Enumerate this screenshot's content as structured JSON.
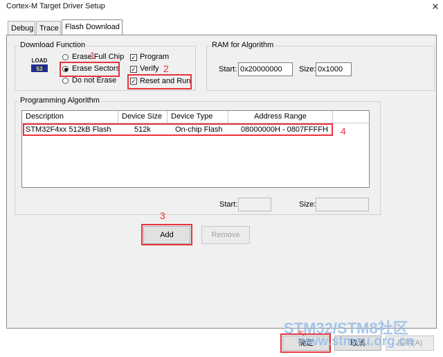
{
  "window": {
    "title": "Cortex-M Target Driver Setup",
    "close_glyph": "✕"
  },
  "tabs": [
    {
      "label": "Debug"
    },
    {
      "label": "Trace"
    },
    {
      "label": "Flash Download"
    }
  ],
  "download_function": {
    "title": "Download Function",
    "load_icon_text": [
      "LOAD",
      "53"
    ],
    "erase_options": [
      {
        "label": "Erase Full Chip",
        "selected": false
      },
      {
        "label": "Erase Sectors",
        "selected": true
      },
      {
        "label": "Do not Erase",
        "selected": false
      }
    ],
    "checkboxes": [
      {
        "label": "Program",
        "checked": true
      },
      {
        "label": "Verify",
        "checked": true
      },
      {
        "label": "Reset and Run",
        "checked": true
      }
    ]
  },
  "ram": {
    "title": "RAM for Algorithm",
    "start_label": "Start:",
    "start_value": "0x20000000",
    "size_label": "Size:",
    "size_value": "0x1000"
  },
  "programming_algorithm": {
    "title": "Programming Algorithm",
    "columns": [
      "Description",
      "Device Size",
      "Device Type",
      "Address Range"
    ],
    "rows": [
      {
        "description": "STM32F4xx 512kB Flash",
        "size": "512k",
        "type": "On-chip Flash",
        "range": "08000000H - 0807FFFFH"
      }
    ],
    "start_label": "Start:",
    "start_value": "",
    "size_label": "Size:",
    "size_value": ""
  },
  "buttons": {
    "add": "Add",
    "remove": "Remove",
    "ok": "确定",
    "cancel": "取消",
    "apply": "应用(A)"
  },
  "annotations": [
    "1",
    "2",
    "3",
    "4",
    "5"
  ],
  "watermark": [
    "STM32/STM8社区",
    "www.stmcu.org.cn"
  ],
  "colors": {
    "annotation_red": "#e8323c",
    "watermark": "#99bde6"
  }
}
